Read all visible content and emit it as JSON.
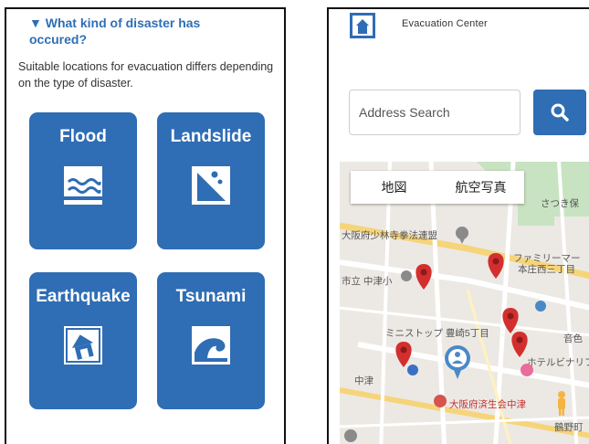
{
  "left_screen": {
    "question": "▼ What kind of disaster has occured?",
    "description": "Suitable locations for evacuation differs depending on the type of disaster.",
    "tiles": [
      {
        "label": "Flood",
        "icon": "flood-icon"
      },
      {
        "label": "Landslide",
        "icon": "landslide-icon"
      },
      {
        "label": "Earthquake",
        "icon": "earthquake-house-icon"
      },
      {
        "label": "Tsunami",
        "icon": "tsunami-wave-icon"
      }
    ]
  },
  "right_screen": {
    "app_title": "Evacuation Center",
    "search": {
      "placeholder": "Address Search",
      "value": ""
    },
    "map_tabs": [
      "地図",
      "航空写真"
    ],
    "map_labels": {
      "temple": "大阪府少林寺拳法連盟",
      "school": "市立 中津小",
      "mart1": "ファミリーマー",
      "mart2": "本庄西三丁目",
      "ministop": "ミニストップ 豊崎5丁目",
      "hotel": "ホテルビナリフ",
      "nakatsu": "中津",
      "hospital": "大阪府済生会中津",
      "satsuki": "さつき保",
      "onshoku": "音色",
      "tsuruno": "鶴野町"
    }
  },
  "colors": {
    "primary": "#2f6db5",
    "pin": "#d32f2f",
    "road": "#ffffff",
    "park": "#c8e3c2"
  }
}
